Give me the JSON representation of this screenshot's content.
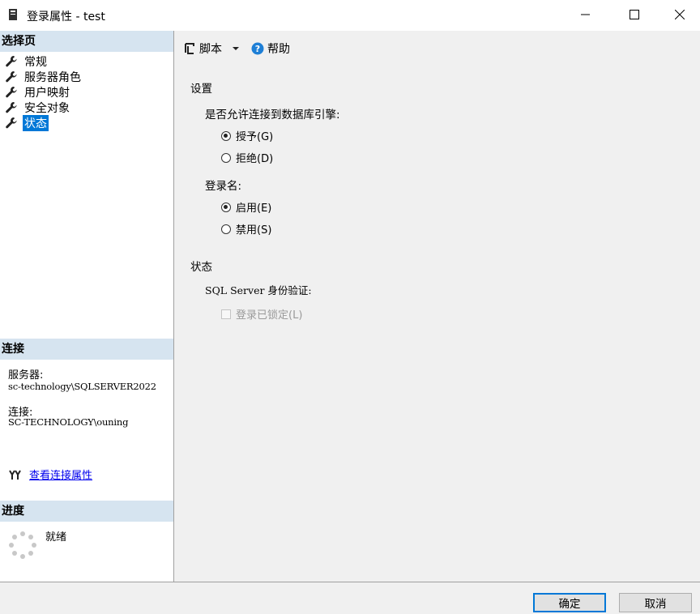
{
  "window": {
    "title": "登录属性 - test",
    "controls": {
      "minimize": "—",
      "maximize": "☐",
      "close": "✕"
    }
  },
  "left": {
    "select_page_header": "选择页",
    "nav_items": [
      {
        "label": "常规",
        "icon": "wrench-icon",
        "selected": false
      },
      {
        "label": "服务器角色",
        "icon": "wrench-icon",
        "selected": false
      },
      {
        "label": "用户映射",
        "icon": "wrench-icon",
        "selected": false
      },
      {
        "label": "安全对象",
        "icon": "wrench-icon",
        "selected": false
      },
      {
        "label": "状态",
        "icon": "wrench-icon",
        "selected": true
      }
    ],
    "connection_header": "连接",
    "server_label": "服务器:",
    "server_value": "sc-technology\\SQLSERVER2022",
    "connection_label": "连接:",
    "connection_value": "SC-TECHNOLOGY\\ouning",
    "view_connection_link": "查看连接属性",
    "progress_header": "进度",
    "progress_status": "就绪"
  },
  "toolbar": {
    "script_label": "脚本",
    "help_label": "帮助"
  },
  "main": {
    "settings_title": "设置",
    "permission_question": "是否允许连接到数据库引擎:",
    "grant_label": "授予(G)",
    "deny_label": "拒绝(D)",
    "grant_selected": true,
    "login_label": "登录名:",
    "enabled_label": "启用(E)",
    "disabled_label": "禁用(S)",
    "enabled_selected": true,
    "status_title": "状态",
    "sql_auth_label": "SQL Server 身份验证:",
    "locked_label": "登录已锁定(L)",
    "locked_checked": false
  },
  "footer": {
    "ok_label": "确定",
    "cancel_label": "取消"
  },
  "colors": {
    "accent": "#0078d7",
    "section_header_bg": "#d6e4f0",
    "panel_bg": "#f0f0f0",
    "link": "#0000ee"
  }
}
